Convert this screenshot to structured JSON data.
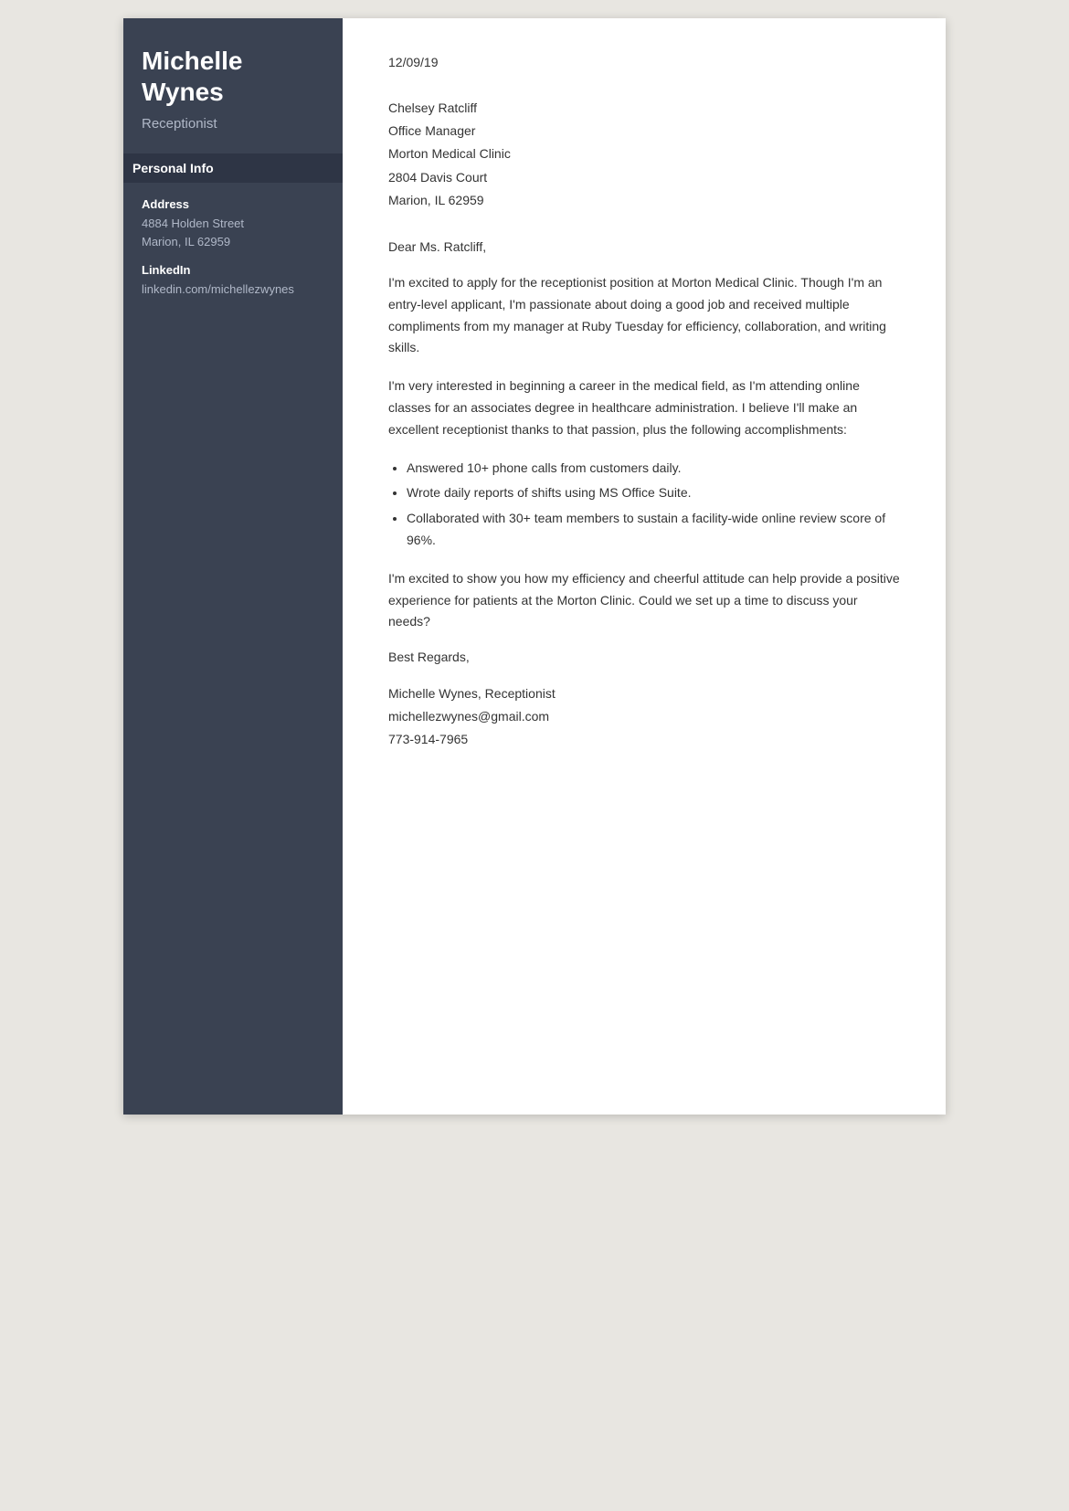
{
  "sidebar": {
    "name_line1": "Michelle",
    "name_line2": "Wynes",
    "title": "Receptionist",
    "personal_info_label": "Personal Info",
    "address_label": "Address",
    "address_line1": "4884 Holden Street",
    "address_line2": "Marion, IL 62959",
    "linkedin_label": "LinkedIn",
    "linkedin_value": "linkedin.com/michellezwynes"
  },
  "letter": {
    "date": "12/09/19",
    "recipient_name": "Chelsey Ratcliff",
    "recipient_title": "Office Manager",
    "recipient_company": "Morton Medical Clinic",
    "recipient_address1": "2804 Davis Court",
    "recipient_address2": "Marion, IL 62959",
    "salutation": "Dear Ms. Ratcliff,",
    "paragraph1": "I'm excited to apply for the receptionist position at Morton Medical Clinic. Though I'm an entry-level applicant, I'm passionate about doing a good job and received multiple compliments from my manager at Ruby Tuesday for efficiency, collaboration, and writing skills.",
    "paragraph2": "I'm very interested in beginning a career in the medical field, as I'm attending online classes for an associates degree in healthcare administration. I believe I'll make an excellent receptionist thanks to that passion, plus the following accomplishments:",
    "bullet1": "Answered 10+ phone calls from customers daily.",
    "bullet2": "Wrote daily reports of shifts using MS Office Suite.",
    "bullet3": "Collaborated with 30+ team members to sustain a facility-wide online review score of 96%.",
    "paragraph3": "I'm excited to show you how my efficiency and cheerful attitude can help provide a positive experience for patients at the Morton Clinic. Could we set up a time to discuss your needs?",
    "closing": "Best Regards,",
    "signature_name": "Michelle Wynes, Receptionist",
    "signature_email": "michellezwynes@gmail.com",
    "signature_phone": "773-914-7965"
  }
}
